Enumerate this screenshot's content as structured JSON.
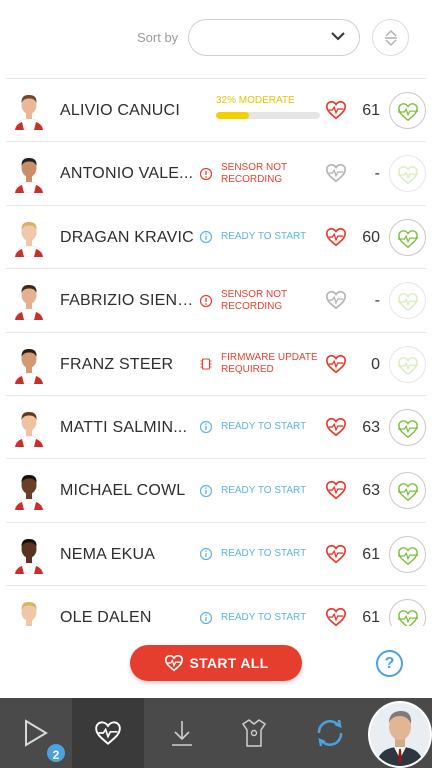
{
  "sort": {
    "label": "Sort by",
    "value": ""
  },
  "athletes": [
    {
      "name": "ALIVIO CANUCI",
      "status_type": "progress",
      "status_text": "32% MODERATE",
      "progress": 0.32,
      "hr": "61",
      "active": true,
      "heart": "red"
    },
    {
      "name": "ANTONIO VALE...",
      "status_type": "warn",
      "status_text": "SENSOR NOT RECORDING",
      "hr": "-",
      "active": false,
      "heart": "gray"
    },
    {
      "name": "DRAGAN KRAVIC",
      "status_type": "info",
      "status_text": "READY TO START",
      "hr": "60",
      "active": true,
      "heart": "red"
    },
    {
      "name": "FABRIZIO SIENTA",
      "status_type": "warn",
      "status_text": "SENSOR NOT RECORDING",
      "hr": "-",
      "active": false,
      "heart": "gray"
    },
    {
      "name": "FRANZ STEER",
      "status_type": "firmware",
      "status_text": "FIRMWARE UPDATE REQUIRED",
      "hr": "0",
      "active": false,
      "heart": "red"
    },
    {
      "name": "MATTI SALMIN...",
      "status_type": "info",
      "status_text": "READY TO START",
      "hr": "63",
      "active": true,
      "heart": "red"
    },
    {
      "name": "MICHAEL COWL",
      "status_type": "info",
      "status_text": "READY TO START",
      "hr": "63",
      "active": true,
      "heart": "red"
    },
    {
      "name": "NEMA EKUA",
      "status_type": "info",
      "status_text": "READY TO START",
      "hr": "61",
      "active": true,
      "heart": "red"
    },
    {
      "name": "OLE DALEN",
      "status_type": "info",
      "status_text": "READY TO START",
      "hr": "61",
      "active": true,
      "heart": "red"
    }
  ],
  "start_button": {
    "label": "START ALL"
  },
  "help": {
    "label": "?"
  },
  "navbar": {
    "play_badge": "2"
  },
  "colors": {
    "accent": "#e53d2e",
    "info": "#5bb4e6",
    "progress": "#f3d000",
    "nav": "#4a4a4a",
    "action_green": "#8cc63f"
  }
}
